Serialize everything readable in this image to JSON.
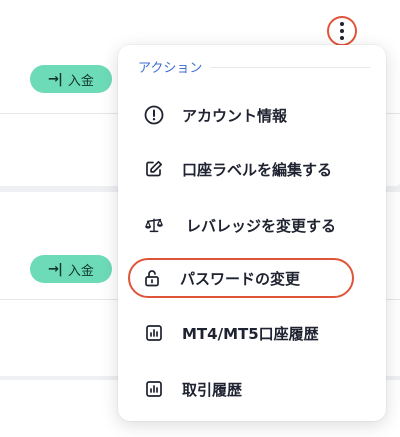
{
  "accounts": [
    {
      "deposit_label": "入金"
    },
    {
      "deposit_label": "入金"
    }
  ],
  "menu": {
    "header": "アクション",
    "items": [
      {
        "label": "アカウント情報",
        "icon": "info-circle-icon"
      },
      {
        "label": "口座ラベルを編集する",
        "icon": "edit-icon"
      },
      {
        "label": "レバレッジを変更する",
        "icon": "scale-icon"
      },
      {
        "label": "パスワードの変更",
        "icon": "unlock-icon",
        "highlighted": true
      },
      {
        "label": "MT4/MT5口座履歴",
        "icon": "chart-icon"
      },
      {
        "label": "取引履歴",
        "icon": "chart-icon"
      }
    ]
  },
  "colors": {
    "deposit_bg": "#6ddbb7",
    "highlight_ring": "#e0543a",
    "menu_header": "#3d6fd1"
  }
}
